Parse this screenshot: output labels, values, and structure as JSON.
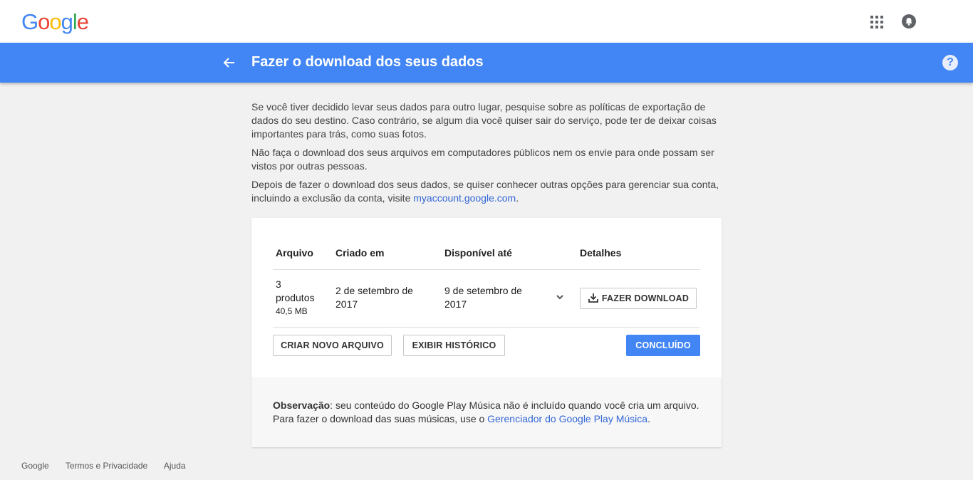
{
  "header": {
    "logo_letters": [
      {
        "char": "G",
        "color": "#4285F4"
      },
      {
        "char": "o",
        "color": "#EA4335"
      },
      {
        "char": "o",
        "color": "#FBBC05"
      },
      {
        "char": "g",
        "color": "#4285F4"
      },
      {
        "char": "l",
        "color": "#34A853"
      },
      {
        "char": "e",
        "color": "#EA4335"
      }
    ],
    "apps_icon": "apps-grid-icon",
    "notifications_icon": "bell-icon"
  },
  "titlebar": {
    "back_icon": "arrow-back-icon",
    "title": "Fazer o download dos seus dados",
    "help_icon": "?",
    "accent_color": "#4285f4"
  },
  "intro": {
    "p1": "Se você tiver decidido levar seus dados para outro lugar, pesquise sobre as políticas de exportação de dados do seu destino. Caso contrário, se algum dia você quiser sair do serviço, pode ter de deixar coisas importantes para trás, como suas fotos.",
    "p2": "Não faça o download dos seus arquivos em computadores públicos nem os envie para onde possam ser vistos por outras pessoas.",
    "p3_before": "Depois de fazer o download dos seus dados, se quiser conhecer outras opções para gerenciar sua conta, incluindo a exclusão da conta, visite ",
    "p3_link": "myaccount.google.com",
    "p3_after": "."
  },
  "archive_table": {
    "columns": [
      "Arquivo",
      "Criado em",
      "Disponível até",
      "Detalhes"
    ],
    "row": {
      "count": "3",
      "products_label": "produtos",
      "size": "40,5 MB",
      "created": "2 de setembro de 2017",
      "available_until": "9 de setembro de 2017",
      "download_label": "FAZER DOWNLOAD"
    }
  },
  "actions": {
    "create_new": "CRIAR NOVO ARQUIVO",
    "view_history": "EXIBIR HISTÓRICO",
    "done": "CONCLUÍDO"
  },
  "note": {
    "label": "Observação",
    "text_before": ": seu conteúdo do Google Play Música não é incluído quando você cria um arquivo. Para fazer o download das suas músicas, use o ",
    "link": "Gerenciador do Google Play Música",
    "text_after": "."
  },
  "footer": {
    "links": [
      "Google",
      "Termos e Privacidade",
      "Ajuda"
    ]
  }
}
